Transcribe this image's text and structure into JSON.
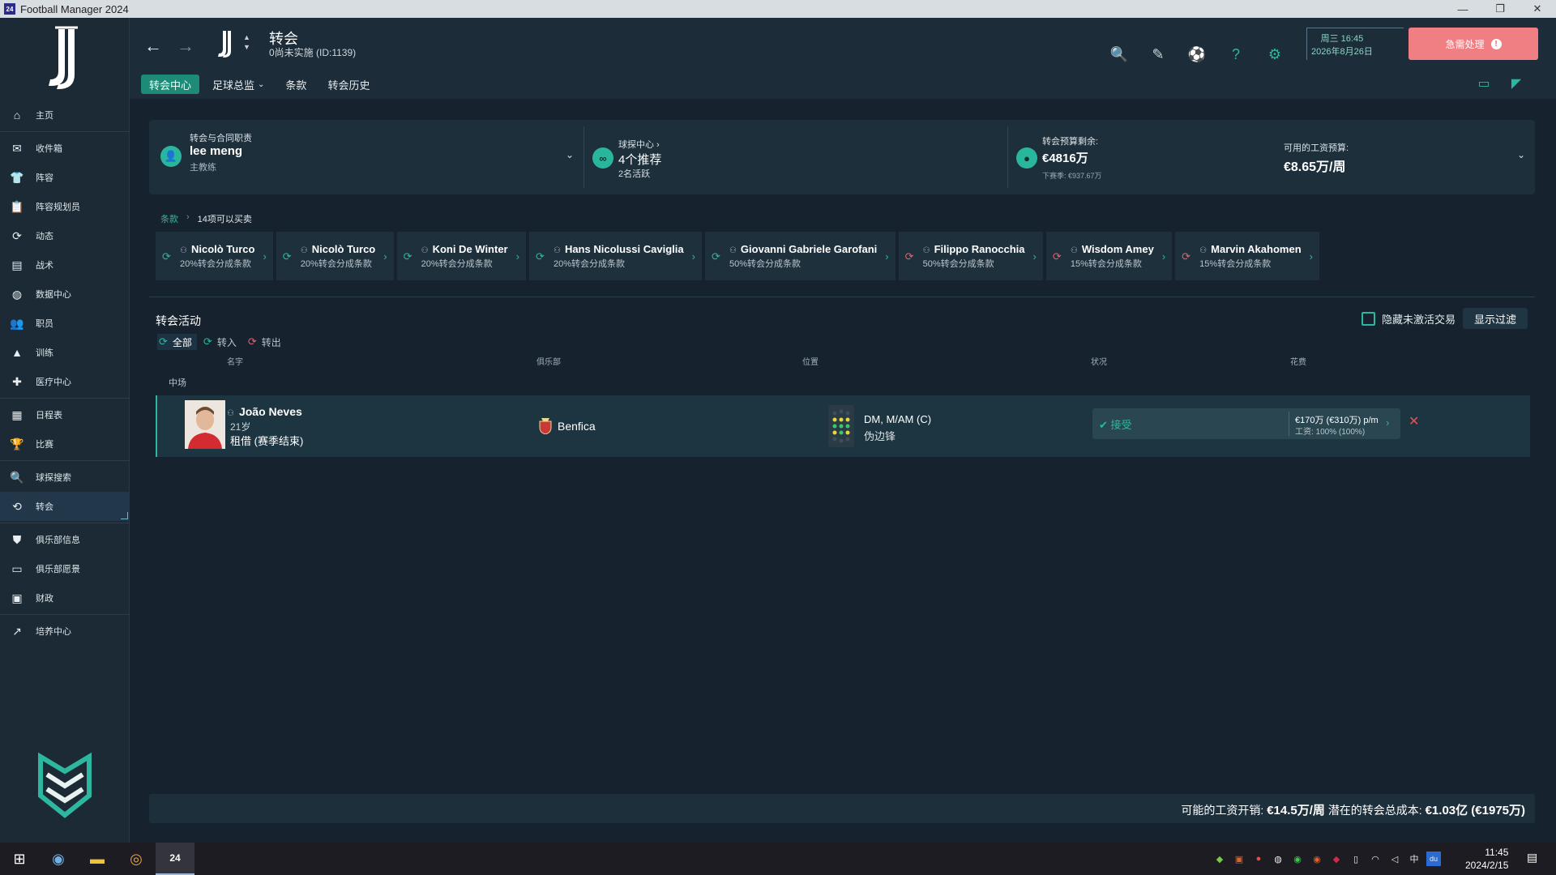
{
  "window": {
    "app_icon_text": "24",
    "title": "Football Manager 2024",
    "controls": [
      "—",
      "❐",
      "✕"
    ]
  },
  "sidebar": {
    "items": [
      {
        "label": "主页",
        "icon": "home-icon",
        "glyph": "⌂"
      },
      {
        "label": "收件箱",
        "icon": "inbox-icon",
        "glyph": "✉"
      },
      {
        "label": "阵容",
        "icon": "shirt-icon",
        "glyph": "👕"
      },
      {
        "label": "阵容规划员",
        "icon": "clipboard-icon",
        "glyph": "📋"
      },
      {
        "label": "动态",
        "icon": "dynamics-icon",
        "glyph": "⟳"
      },
      {
        "label": "战术",
        "icon": "tactics-icon",
        "glyph": "▤"
      },
      {
        "label": "数据中心",
        "icon": "data-icon",
        "glyph": "◍"
      },
      {
        "label": "职员",
        "icon": "staff-icon",
        "glyph": "👥"
      },
      {
        "label": "训练",
        "icon": "training-icon",
        "glyph": "▲"
      },
      {
        "label": "医疗中心",
        "icon": "medical-icon",
        "glyph": "✚"
      },
      {
        "label": "日程表",
        "icon": "calendar-icon",
        "glyph": "▦"
      },
      {
        "label": "比赛",
        "icon": "trophy-icon",
        "glyph": "🏆"
      },
      {
        "label": "球探搜索",
        "icon": "search-icon",
        "glyph": "🔍"
      },
      {
        "label": "转会",
        "icon": "transfer-icon",
        "glyph": "⟲"
      },
      {
        "label": "俱乐部信息",
        "icon": "shield-icon",
        "glyph": "⛊"
      },
      {
        "label": "俱乐部愿景",
        "icon": "vision-icon",
        "glyph": "▭"
      },
      {
        "label": "财政",
        "icon": "finance-icon",
        "glyph": "▣"
      },
      {
        "label": "培养中心",
        "icon": "development-icon",
        "glyph": "↗"
      }
    ]
  },
  "header": {
    "title": "转会",
    "subtitle": "0尚未实施 (ID:1139)",
    "tabs": [
      "转会中心",
      "足球总监",
      "条款",
      "转会历史"
    ],
    "dropdown_caret": "⌄",
    "date_line1": "周三 16:45",
    "date_line2": "2026年8月26日",
    "urgent_label": "急需处理",
    "urgent_badge": "!",
    "icon_glyphs": [
      "🔍",
      "✎",
      "⚽",
      "?",
      "⚙"
    ],
    "right_glyphs": [
      "▭",
      "◤"
    ]
  },
  "summary": {
    "role_label": "转会与合同职责",
    "manager_name": "lee meng",
    "manager_role": "主教练",
    "scout_label": "球探中心",
    "scout_recs": "4个推荐",
    "scout_active": "2名活跃",
    "budget_label": "转会预算剩余:",
    "budget_value": "€4816万",
    "budget_next": "下赛季: €937.67万",
    "wage_label": "可用的工资预算:",
    "wage_value": "€8.65万/周"
  },
  "breadcrumb": {
    "link": "条款",
    "sep": "›",
    "current": "14项可以买卖"
  },
  "clauses": [
    {
      "name": "Nicolò Turco",
      "pct": "20%转会分成条款",
      "color": "green"
    },
    {
      "name": "Nicolò Turco",
      "pct": "20%转会分成条款",
      "color": "green"
    },
    {
      "name": "Koni De Winter",
      "pct": "20%转会分成条款",
      "color": "green"
    },
    {
      "name": "Hans Nicolussi Caviglia",
      "pct": "20%转会分成条款",
      "color": "green"
    },
    {
      "name": "Giovanni Gabriele Garofani",
      "pct": "50%转会分成条款",
      "color": "green"
    },
    {
      "name": "Filippo Ranocchia",
      "pct": "50%转会分成条款",
      "color": "red"
    },
    {
      "name": "Wisdom Amey",
      "pct": "15%转会分成条款",
      "color": "red"
    },
    {
      "name": "Marvin Akahomen",
      "pct": "15%转会分成条款",
      "color": "red"
    }
  ],
  "activity": {
    "title": "转会活动",
    "hide_inactive": "隐藏未激活交易",
    "filter_btn": "显示过滤",
    "tabs": [
      {
        "label": "全部",
        "color": "green"
      },
      {
        "label": "转入",
        "color": "green"
      },
      {
        "label": "转出",
        "color": "red"
      }
    ],
    "columns": [
      "名字",
      "俱乐部",
      "位置",
      "状况",
      "花费"
    ],
    "group": "中场",
    "row": {
      "name": "João Neves",
      "age": "21岁",
      "contract": "租借 (赛季结束)",
      "club": "Benfica",
      "position": "DM, M/AM (C)",
      "role": "伪边锋",
      "status": "✔ 接受",
      "fee_line1": "€170万 (€310万) p/m",
      "fee_line2": "工资: 100% (100%)"
    }
  },
  "footer": {
    "wage_label": "可能的工资开销:",
    "wage_value": "€14.5万/周",
    "cost_label": "潜在的转会总成本:",
    "cost_value": "€1.03亿 (€1975万)"
  },
  "taskbar": {
    "app_badge": "24",
    "tray_ime": "中",
    "time": "11:45",
    "date": "2024/2/15"
  },
  "colors": {
    "accent": "#2db7a0",
    "danger": "#e0626a",
    "urgent": "#f07f84"
  }
}
